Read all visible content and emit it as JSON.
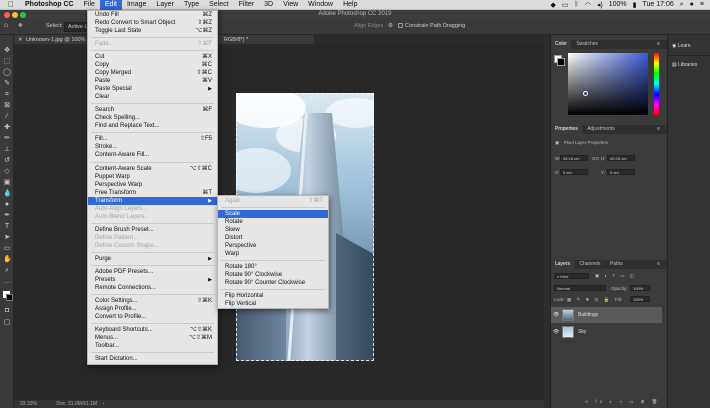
{
  "mac_menubar": {
    "apple": "",
    "app": "Photoshop CC",
    "items": [
      "File",
      "Edit",
      "Image",
      "Layer",
      "Type",
      "Select",
      "Filter",
      "3D",
      "View",
      "Window",
      "Help"
    ],
    "battery": "100%",
    "clock": "Tue 17:06"
  },
  "window": {
    "title": "Adobe Photoshop CC 2019"
  },
  "options_bar": {
    "select_label": "Select:",
    "select_value": "Active La",
    "align_edges": "Align Edges",
    "constrain": "Constrain Path Dragging"
  },
  "document": {
    "tab": "Unknown-1.jpg @ 100%",
    "tab_suffix": "RGB/8*) *",
    "zoom": "33.33%",
    "doc_info": "Doc: 31.0M/61.1M"
  },
  "edit_menu": {
    "items": [
      {
        "label": "Undo Fill",
        "shortcut": "⌘Z"
      },
      {
        "label": "Redo Convert to Smart Object",
        "shortcut": "⇧⌘Z"
      },
      {
        "label": "Toggle Last State",
        "shortcut": "⌥⌘Z"
      },
      {
        "label": "Fade...",
        "shortcut": "⇧⌘F"
      },
      {
        "label": "Cut",
        "shortcut": "⌘X"
      },
      {
        "label": "Copy",
        "shortcut": "⌘C"
      },
      {
        "label": "Copy Merged",
        "shortcut": "⇧⌘C"
      },
      {
        "label": "Paste",
        "shortcut": "⌘V"
      },
      {
        "label": "Paste Special",
        "shortcut": ""
      },
      {
        "label": "Clear",
        "shortcut": ""
      },
      {
        "label": "Search",
        "shortcut": "⌘F"
      },
      {
        "label": "Check Spelling...",
        "shortcut": ""
      },
      {
        "label": "Find and Replace Text...",
        "shortcut": ""
      },
      {
        "label": "Fill...",
        "shortcut": "⇧F5"
      },
      {
        "label": "Stroke...",
        "shortcut": ""
      },
      {
        "label": "Content-Aware Fill...",
        "shortcut": ""
      },
      {
        "label": "Content-Aware Scale",
        "shortcut": "⌥⇧⌘C"
      },
      {
        "label": "Puppet Warp",
        "shortcut": ""
      },
      {
        "label": "Perspective Warp",
        "shortcut": ""
      },
      {
        "label": "Free Transform",
        "shortcut": "⌘T"
      },
      {
        "label": "Transform",
        "shortcut": ""
      },
      {
        "label": "Auto-Align Layers...",
        "shortcut": ""
      },
      {
        "label": "Auto-Blend Layers...",
        "shortcut": ""
      },
      {
        "label": "Define Brush Preset...",
        "shortcut": ""
      },
      {
        "label": "Define Pattern...",
        "shortcut": ""
      },
      {
        "label": "Define Custom Shape...",
        "shortcut": ""
      },
      {
        "label": "Purge",
        "shortcut": ""
      },
      {
        "label": "Adobe PDF Presets...",
        "shortcut": ""
      },
      {
        "label": "Presets",
        "shortcut": ""
      },
      {
        "label": "Remote Connections...",
        "shortcut": ""
      },
      {
        "label": "Color Settings...",
        "shortcut": "⇧⌘K"
      },
      {
        "label": "Assign Profile...",
        "shortcut": ""
      },
      {
        "label": "Convert to Profile...",
        "shortcut": ""
      },
      {
        "label": "Keyboard Shortcuts...",
        "shortcut": "⌥⇧⌘K"
      },
      {
        "label": "Menus...",
        "shortcut": "⌥⇧⌘M"
      },
      {
        "label": "Toolbar...",
        "shortcut": ""
      },
      {
        "label": "Start Dictation...",
        "shortcut": ""
      }
    ]
  },
  "transform_submenu": {
    "items": [
      {
        "label": "Again",
        "shortcut": "⇧⌘T"
      },
      {
        "label": "Scale",
        "shortcut": ""
      },
      {
        "label": "Rotate",
        "shortcut": ""
      },
      {
        "label": "Skew",
        "shortcut": ""
      },
      {
        "label": "Distort",
        "shortcut": ""
      },
      {
        "label": "Perspective",
        "shortcut": ""
      },
      {
        "label": "Warp",
        "shortcut": ""
      },
      {
        "label": "Rotate 180°",
        "shortcut": ""
      },
      {
        "label": "Rotate 90° Clockwise",
        "shortcut": ""
      },
      {
        "label": "Rotate 90° Counter Clockwise",
        "shortcut": ""
      },
      {
        "label": "Flip Horizontal",
        "shortcut": ""
      },
      {
        "label": "Flip Vertical",
        "shortcut": ""
      }
    ]
  },
  "color_panel": {
    "tabs": [
      "Color",
      "Swatches"
    ],
    "accent": "#2f6ad6"
  },
  "properties_panel": {
    "tabs": [
      "Properties",
      "Adjustments"
    ],
    "subtitle": "Pixel Layer Properties",
    "w_label": "W:",
    "w_value": "35.18 cm",
    "h_label": "H:",
    "h_value": "40.28 cm",
    "x_label": "X:",
    "x_value": "0 cm",
    "y_label": "Y:",
    "y_value": "0 cm",
    "go_label": "GO"
  },
  "layers_panel": {
    "tabs": [
      "Layers",
      "Channels",
      "Paths"
    ],
    "kind": "Kind",
    "blend_mode": "Normal",
    "opacity_label": "Opacity:",
    "opacity_value": "100%",
    "lock_label": "Lock:",
    "fill_label": "Fill:",
    "fill_value": "100%",
    "layers": [
      {
        "name": "Buildings",
        "selected": true
      },
      {
        "name": "Sky",
        "selected": false
      }
    ]
  },
  "learn_panel": {
    "learn": "Learn",
    "libraries": "Libraries"
  }
}
